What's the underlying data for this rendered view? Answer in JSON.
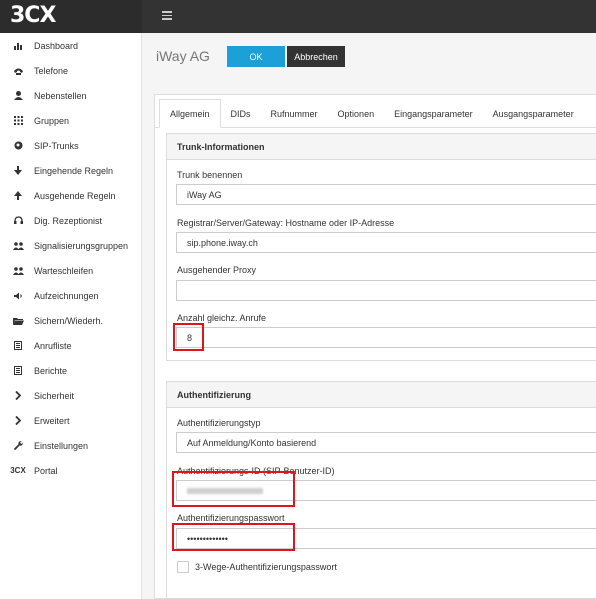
{
  "header": {
    "logo": "3CX"
  },
  "sidebar": {
    "items": [
      {
        "label": "Dashboard",
        "icon": "bar-chart-icon"
      },
      {
        "label": "Telefone",
        "icon": "phone-icon"
      },
      {
        "label": "Nebenstellen",
        "icon": "user-icon"
      },
      {
        "label": "Gruppen",
        "icon": "grid-icon"
      },
      {
        "label": "SIP-Trunks",
        "icon": "globe-icon"
      },
      {
        "label": "Eingehende Regeln",
        "icon": "arrow-down-icon"
      },
      {
        "label": "Ausgehende Regeln",
        "icon": "arrow-up-icon"
      },
      {
        "label": "Dig. Rezeptionist",
        "icon": "headset-icon"
      },
      {
        "label": "Signalisierungsgruppen",
        "icon": "users-icon"
      },
      {
        "label": "Warteschleifen",
        "icon": "users-icon"
      },
      {
        "label": "Aufzeichnungen",
        "icon": "speaker-icon"
      },
      {
        "label": "Sichern/Wiederh.",
        "icon": "folder-icon"
      },
      {
        "label": "Anrufliste",
        "icon": "list-icon"
      },
      {
        "label": "Berichte",
        "icon": "list-icon"
      },
      {
        "label": "Sicherheit",
        "icon": "chevron-right-icon"
      },
      {
        "label": "Erweitert",
        "icon": "chevron-right-icon"
      },
      {
        "label": "Einstellungen",
        "icon": "wrench-icon"
      },
      {
        "label": "Portal",
        "icon": "3cx-icon"
      }
    ],
    "portal_icon_text": "3CX"
  },
  "page": {
    "title": "iWay AG",
    "ok_label": "OK",
    "cancel_label": "Abbrechen"
  },
  "tabs": [
    "Allgemein",
    "DIDs",
    "Rufnummer",
    "Optionen",
    "Eingangsparameter",
    "Ausgangsparameter"
  ],
  "trunk_info": {
    "heading": "Trunk-Informationen",
    "name_label": "Trunk benennen",
    "name_value": "iWay AG",
    "registrar_label": "Registrar/Server/Gateway: Hostname oder IP-Adresse",
    "registrar_value": "sip.phone.iway.ch",
    "proxy_label": "Ausgehender Proxy",
    "proxy_value": "",
    "calls_label": "Anzahl gleichz. Anrufe",
    "calls_value": "8"
  },
  "auth": {
    "heading": "Authentifizierung",
    "type_label": "Authentifizierungstyp",
    "type_value": "Auf Anmeldung/Konto basierend",
    "id_label": "Authentifizierungs-ID (SIP-Benutzer-ID)",
    "password_label": "Authentifizierungspasswort",
    "password_value": "•••••••••••••",
    "threeway_label": "3-Wege-Authentifizierungspasswort"
  },
  "colors": {
    "accent": "#1ba1d8",
    "highlight": "#e0141c",
    "dark": "#333333"
  }
}
